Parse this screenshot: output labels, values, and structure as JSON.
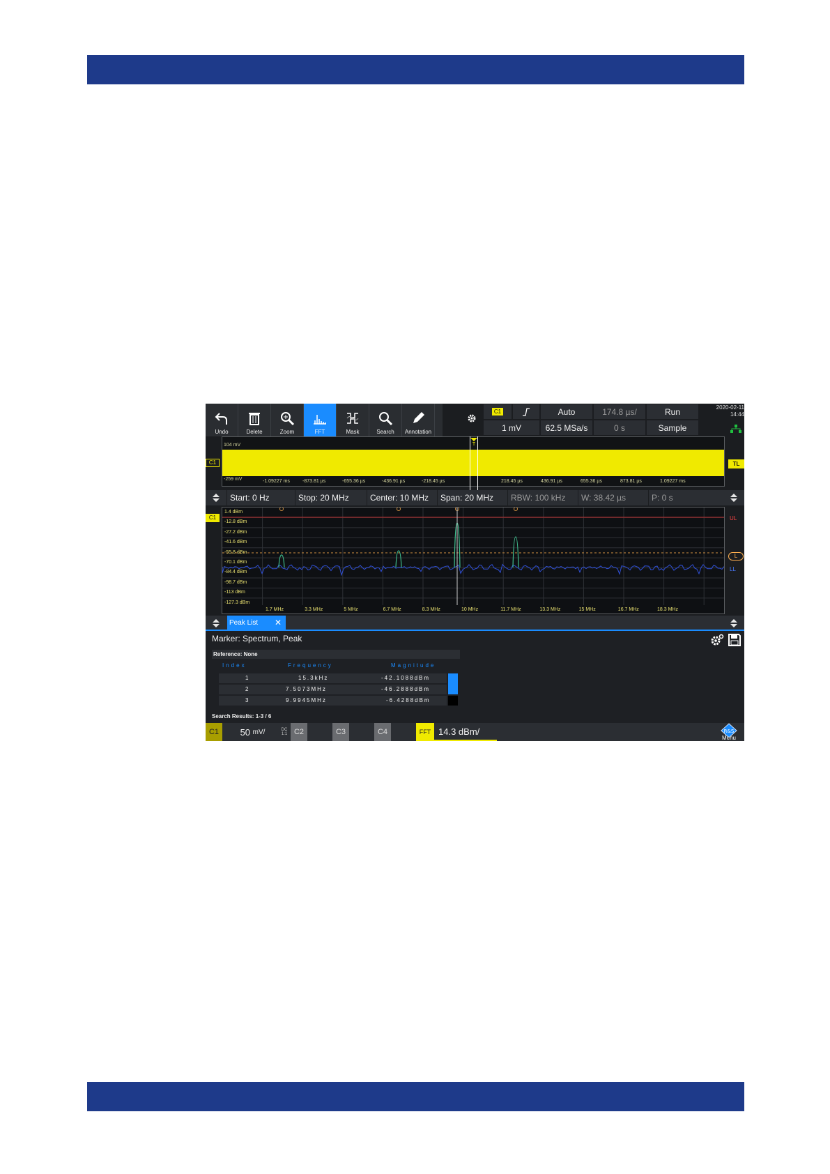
{
  "toolbar": {
    "undo": "Undo",
    "delete": "Delete",
    "zoom": "Zoom",
    "fft": "FFT",
    "mask": "Mask",
    "search": "Search",
    "annotation": "Annotation"
  },
  "hsettings": {
    "channel": "C1",
    "auto": "Auto",
    "timebase": "174.8 µs/",
    "run": "Run",
    "level": "1 mV",
    "samplerate": "62.5 MSa/s",
    "offset": "0 s",
    "acq": "Sample"
  },
  "clock": {
    "date": "2020-02-11",
    "time": "14:44"
  },
  "timediag": {
    "top_label": "104 mV",
    "bottom_label": "-259 mV",
    "channel_tag": "C1",
    "trigger_level_tag": "TL",
    "ticks": [
      "-1.09227 ms",
      "-873.81 µs",
      "-655.36 µs",
      "-436.91 µs",
      "-218.45 µs",
      "0 s",
      "218.45 µs",
      "436.91 µs",
      "655.36 µs",
      "873.81 µs",
      "1.09227 ms"
    ]
  },
  "fftparams": {
    "start": "Start: 0 Hz",
    "stop": "Stop: 20 MHz",
    "center": "Center: 10 MHz",
    "span": "Span: 20 MHz",
    "rbw": "RBW: 100 kHz",
    "w": "W: 38.42 µs",
    "p": "P: 0 s"
  },
  "spectrum": {
    "channel_tag": "C1",
    "ul_tag": "UL",
    "l_tag": "L",
    "ll_tag": "LL",
    "y_labels": [
      "1.4 dBm",
      "-12.8 dBm",
      "-27.2 dBm",
      "-41.6 dBm",
      "-55.8 dBm",
      "-70.1 dBm",
      "-84.4 dBm",
      "-98.7 dBm",
      "-113 dBm",
      "-127.3 dBm"
    ],
    "x_labels": [
      "1.7 MHz",
      "3.3 MHz",
      "5 MHz",
      "6.7 MHz",
      "8.3 MHz",
      "10 MHz",
      "11.7 MHz",
      "13.3 MHz",
      "15 MHz",
      "16.7 MHz",
      "18.3 MHz"
    ],
    "colors": {
      "trace": "#3050d8",
      "peak": "#40c090",
      "limit_upper": "#c03030",
      "limit": "#d09040"
    }
  },
  "peaklist": {
    "tab_label": "Peak List",
    "close": "✕",
    "title": "Marker: Spectrum, Peak",
    "reference": "Reference: None",
    "headers": {
      "index": "Index",
      "frequency": "Frequency",
      "magnitude": "Magnitude"
    },
    "rows": [
      {
        "index": "1",
        "frequency": "15.3kHz",
        "magnitude": "-42.1088dBm"
      },
      {
        "index": "2",
        "frequency": "7.5073MHz",
        "magnitude": "-46.2888dBm"
      },
      {
        "index": "3",
        "frequency": "9.9945MHz",
        "magnitude": "-6.4288dBm"
      }
    ],
    "search_results": "Search Results:  1-3 / 6"
  },
  "status": {
    "c1": "C1",
    "c1_scale": "50",
    "c1_unit": "mV/",
    "dc": "DC",
    "ratio": "1:1",
    "c2": "C2",
    "c3": "C3",
    "c4": "C4",
    "fft": "FFT",
    "fft_scale": "14.3 dBm/",
    "menu": "Menu"
  }
}
